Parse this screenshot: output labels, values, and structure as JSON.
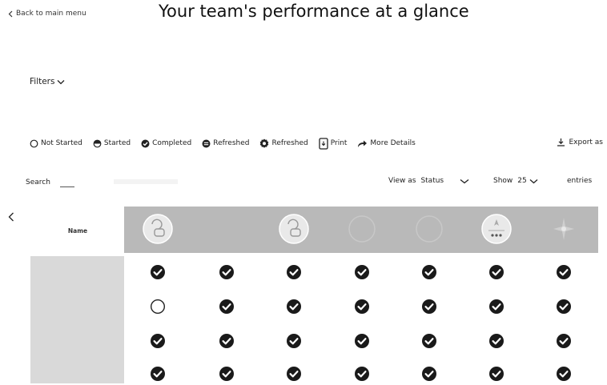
{
  "header": {
    "back_label": "Back to main menu",
    "title": "Your team's performance at a glance"
  },
  "filters": {
    "label": "Filters"
  },
  "legend": {
    "items": [
      {
        "label": "Not Started",
        "icon": "circle-outline-icon"
      },
      {
        "label": "Started",
        "icon": "half-circle-icon"
      },
      {
        "label": "Completed",
        "icon": "check-circle-icon"
      },
      {
        "label": "Refreshed",
        "icon": "refresh-circle-icon"
      },
      {
        "label": "Refreshed",
        "icon": "refresh-badge-icon"
      },
      {
        "label": "Print",
        "icon": "print-icon"
      },
      {
        "label": "More Details",
        "icon": "share-arrow-icon"
      }
    ]
  },
  "export": {
    "label": "Export as"
  },
  "controls": {
    "search_label": "Search",
    "view_as_label": "View as",
    "view_as_value": "Status",
    "show_label": "Show",
    "show_value": "25",
    "entries_label": "entries"
  },
  "table": {
    "name_header": "Name",
    "columns": [
      {
        "icon": "touch-hand-icon",
        "style": "light"
      },
      {
        "icon": "blank-icon",
        "style": "none"
      },
      {
        "icon": "touch-hand-icon",
        "style": "light"
      },
      {
        "icon": "faded-circle-icon",
        "style": "faint"
      },
      {
        "icon": "faded-circle-icon",
        "style": "faint"
      },
      {
        "icon": "person-dots-icon",
        "style": "light"
      },
      {
        "icon": "sparkle-icon",
        "style": "faint"
      }
    ],
    "rows": [
      [
        "completed",
        "completed",
        "completed",
        "completed",
        "completed",
        "completed",
        "completed"
      ],
      [
        "not_started",
        "completed",
        "completed",
        "completed",
        "completed",
        "completed",
        "completed"
      ],
      [
        "completed",
        "completed",
        "completed",
        "completed",
        "completed",
        "completed",
        "completed"
      ],
      [
        "completed",
        "completed",
        "completed",
        "completed",
        "completed",
        "completed",
        "completed"
      ]
    ]
  },
  "colors": {
    "header_band": "#b9b9b9",
    "name_column": "#d9d9d9",
    "check_fill": "#1a1a1a"
  }
}
